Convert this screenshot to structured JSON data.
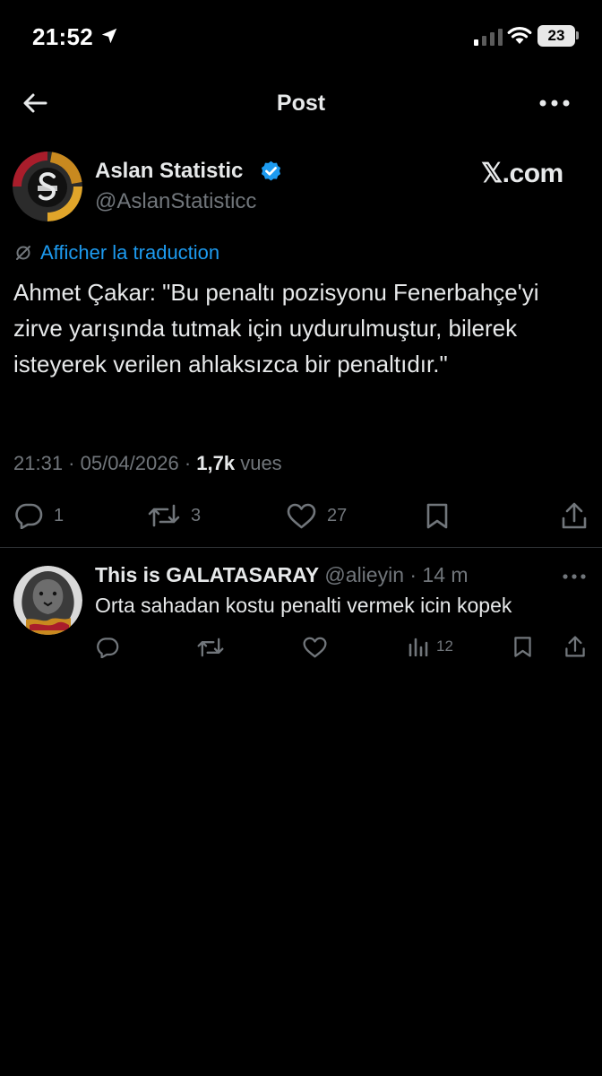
{
  "status_bar": {
    "time": "21:52",
    "battery": "23",
    "icons": [
      "location-arrow-icon",
      "cellular-signal-icon",
      "wifi-icon",
      "battery-icon"
    ]
  },
  "nav": {
    "title": "Post",
    "icons": [
      "back-arrow-icon",
      "more-options-icon"
    ]
  },
  "tweet": {
    "author_name": "Aslan Statistic",
    "author_handle": "@AslanStatisticc",
    "source_badge": "𝕏.com",
    "translate_label": "Afficher la traduction",
    "text": "Ahmet Çakar: \"Bu penaltı pozisyonu Fenerbahçe'yi zirve yarışında tutmak için uydurulmuştur, bilerek isteyerek verilen ahlaksızca bir penaltıdır.\"",
    "meta_prefix": "21:31 · 05/04/2026 · ",
    "views_count": "1,7k",
    "views_label": " vues",
    "actions": {
      "replies": "1",
      "reposts": "3",
      "likes": "27"
    }
  },
  "reply": {
    "author_name": "This is GALATASARAY",
    "author_handle": " @alieyin · 14 m",
    "text": "Orta sahadan kostu penalti vermek icin kopek",
    "actions": {
      "views": "12"
    }
  },
  "colors": {
    "background": "#000000",
    "text": "#e7e9ea",
    "muted": "#71767b",
    "link": "#1d9bf0",
    "verified": "#1d9bf0",
    "divider": "#2f3336"
  }
}
